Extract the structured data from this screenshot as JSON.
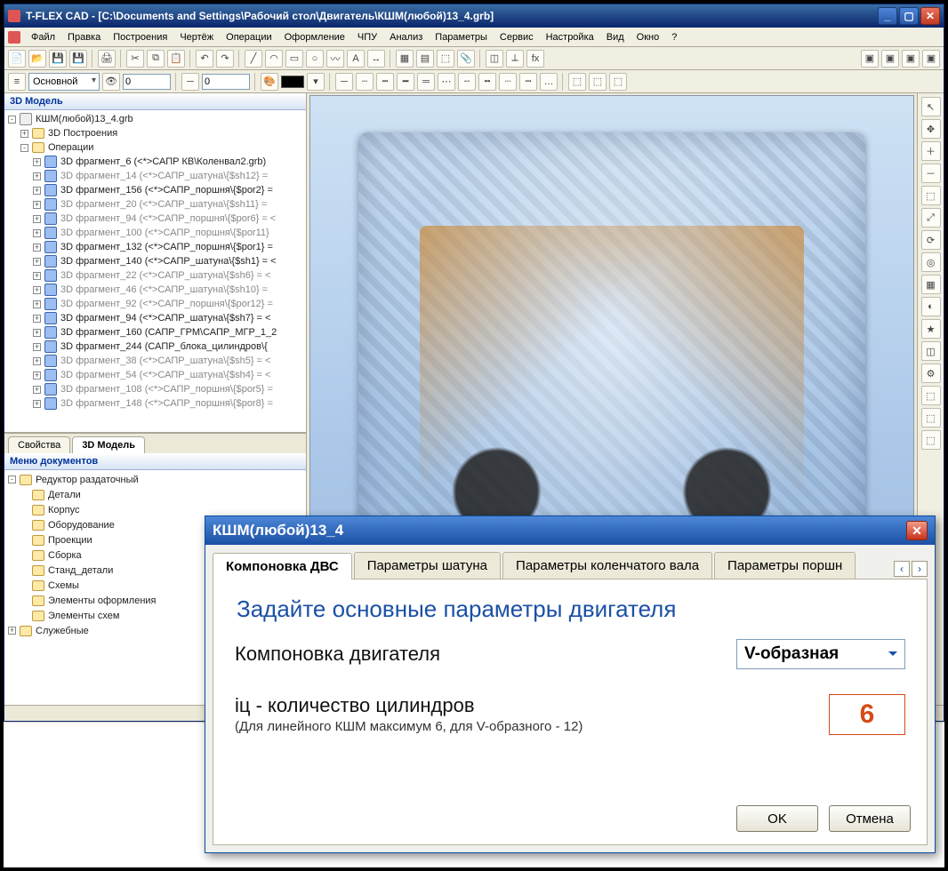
{
  "titlebar": {
    "app": "T-FLEX CAD",
    "path": "[C:\\Documents and Settings\\Рабочий стол\\Двигатель\\КШМ(любой)13_4.grb]"
  },
  "menu": [
    "Файл",
    "Правка",
    "Построения",
    "Чертёж",
    "Операции",
    "Оформление",
    "ЧПУ",
    "Анализ",
    "Параметры",
    "Сервис",
    "Настройка",
    "Вид",
    "Окно",
    "?"
  ],
  "toolbar2": {
    "layer": "Основной",
    "val_a": "0",
    "val_b": "0"
  },
  "panel_titles": {
    "model": "3D Модель",
    "docs": "Меню документов"
  },
  "model_tree": [
    {
      "d": 0,
      "dim": false,
      "kind": "doc",
      "exp": "-",
      "label": "КШМ(любой)13_4.grb"
    },
    {
      "d": 1,
      "dim": false,
      "kind": "fold",
      "exp": "+",
      "label": "3D Построения"
    },
    {
      "d": 1,
      "dim": false,
      "kind": "fold",
      "exp": "-",
      "label": "Операции"
    },
    {
      "d": 2,
      "dim": false,
      "kind": "op",
      "exp": "+",
      "label": "3D фрагмент_6 (<*>САПР КВ\\Коленвал2.grb)"
    },
    {
      "d": 2,
      "dim": true,
      "kind": "op",
      "exp": "+",
      "label": "3D фрагмент_14 (<*>САПР_шатуна\\{$sh12} ="
    },
    {
      "d": 2,
      "dim": false,
      "kind": "op",
      "exp": "+",
      "label": "3D фрагмент_156 (<*>САПР_поршня\\{$por2} ="
    },
    {
      "d": 2,
      "dim": true,
      "kind": "op",
      "exp": "+",
      "label": "3D фрагмент_20 (<*>САПР_шатуна\\{$sh11} ="
    },
    {
      "d": 2,
      "dim": true,
      "kind": "op",
      "exp": "+",
      "label": "3D фрагмент_94 (<*>САПР_поршня\\{$por6} = <"
    },
    {
      "d": 2,
      "dim": true,
      "kind": "op",
      "exp": "+",
      "label": "3D фрагмент_100 (<*>САПР_поршня\\{$por11}"
    },
    {
      "d": 2,
      "dim": false,
      "kind": "op",
      "exp": "+",
      "label": "3D фрагмент_132 (<*>САПР_поршня\\{$por1} ="
    },
    {
      "d": 2,
      "dim": false,
      "kind": "op",
      "exp": "+",
      "label": "3D фрагмент_140 (<*>САПР_шатуна\\{$sh1} = <"
    },
    {
      "d": 2,
      "dim": true,
      "kind": "op",
      "exp": "+",
      "label": "3D фрагмент_22 (<*>САПР_шатуна\\{$sh6} = <"
    },
    {
      "d": 2,
      "dim": true,
      "kind": "op",
      "exp": "+",
      "label": "3D фрагмент_46 (<*>САПР_шатуна\\{$sh10} ="
    },
    {
      "d": 2,
      "dim": true,
      "kind": "op",
      "exp": "+",
      "label": "3D фрагмент_92 (<*>САПР_поршня\\{$por12} ="
    },
    {
      "d": 2,
      "dim": false,
      "kind": "op",
      "exp": "+",
      "label": "3D фрагмент_94 (<*>САПР_шатуна\\{$sh7} = <"
    },
    {
      "d": 2,
      "dim": false,
      "kind": "op",
      "exp": "+",
      "label": "3D фрагмент_160 (САПР_ГРМ\\САПР_МГР_1_2"
    },
    {
      "d": 2,
      "dim": false,
      "kind": "op",
      "exp": "+",
      "label": "3D фрагмент_244 (САПР_блока_цилиндров\\{"
    },
    {
      "d": 2,
      "dim": true,
      "kind": "op",
      "exp": "+",
      "label": "3D фрагмент_38 (<*>САПР_шатуна\\{$sh5} = <"
    },
    {
      "d": 2,
      "dim": true,
      "kind": "op",
      "exp": "+",
      "label": "3D фрагмент_54 (<*>САПР_шатуна\\{$sh4} = <"
    },
    {
      "d": 2,
      "dim": true,
      "kind": "op",
      "exp": "+",
      "label": "3D фрагмент_108 (<*>САПР_поршня\\{$por5} ="
    },
    {
      "d": 2,
      "dim": true,
      "kind": "op",
      "exp": "+",
      "label": "3D фрагмент_148 (<*>САПР_поршня\\{$por8} ="
    }
  ],
  "model_tabs": [
    "Свойства",
    "3D Модель"
  ],
  "docs_tree": [
    {
      "d": 0,
      "exp": "-",
      "kind": "fold",
      "label": "Редуктор раздаточный"
    },
    {
      "d": 1,
      "exp": "",
      "kind": "fold",
      "label": "Детали"
    },
    {
      "d": 1,
      "exp": "",
      "kind": "fold",
      "label": "Корпус"
    },
    {
      "d": 1,
      "exp": "",
      "kind": "fold",
      "label": "Оборудование"
    },
    {
      "d": 1,
      "exp": "",
      "kind": "fold",
      "label": "Проекции"
    },
    {
      "d": 1,
      "exp": "",
      "kind": "fold",
      "label": "Сборка"
    },
    {
      "d": 1,
      "exp": "",
      "kind": "fold",
      "label": "Станд_детали"
    },
    {
      "d": 1,
      "exp": "",
      "kind": "fold",
      "label": "Схемы"
    },
    {
      "d": 1,
      "exp": "",
      "kind": "fold",
      "label": "Элементы оформления"
    },
    {
      "d": 1,
      "exp": "",
      "kind": "fold",
      "label": "Элементы схем"
    },
    {
      "d": 0,
      "exp": "+",
      "kind": "fold",
      "label": "Служебные"
    }
  ],
  "dialog": {
    "title": "КШМ(любой)13_4",
    "tabs": [
      "Компоновка ДВС",
      "Параметры шатуна",
      "Параметры коленчатого вала",
      "Параметры поршн"
    ],
    "heading": "Задайте основные параметры двигателя",
    "layout_label": "Компоновка двигателя",
    "layout_value": "V-образная",
    "cyl_label": "iц  - количество цилиндров",
    "cyl_hint": "(Для линейного КШМ максимум 6, для V-образного - 12)",
    "cyl_value": "6",
    "ok": "OK",
    "cancel": "Отмена"
  }
}
